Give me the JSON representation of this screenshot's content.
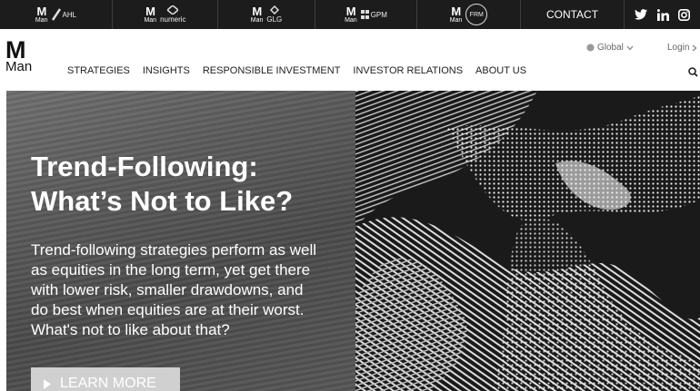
{
  "topbar": {
    "brands": [
      {
        "m": "M",
        "man": "Man",
        "sub": "AHL",
        "icon": "ahl-slash-icon"
      },
      {
        "m": "M",
        "man": "Man",
        "sub": "numeric",
        "icon": "numeric-diamond-icon"
      },
      {
        "m": "M",
        "man": "Man",
        "sub": "GLG",
        "icon": "glg-knot-icon"
      },
      {
        "m": "M",
        "man": "Man",
        "sub": "GPM",
        "icon": "gpm-grid-icon"
      },
      {
        "m": "M",
        "man": "Man",
        "sub": "FRM",
        "icon": "frm-circle-icon"
      }
    ],
    "contact": "CONTACT",
    "social": [
      "twitter-icon",
      "linkedin-icon",
      "instagram-icon"
    ]
  },
  "header": {
    "logo": {
      "big": "M",
      "small": "Man"
    },
    "nav": [
      "STRATEGIES",
      "INSIGHTS",
      "RESPONSIBLE INVESTMENT",
      "INVESTOR RELATIONS",
      "ABOUT US"
    ],
    "global": "Global",
    "login": "Login"
  },
  "hero": {
    "headline_line1": "Trend-Following:",
    "headline_line2": "What’s Not to Like?",
    "description_lines": [
      "Trend-following strategies perform as well",
      "as equities in the long term, yet get there",
      "with lower risk, smaller drawdowns, and",
      "do best when equities are at their worst.",
      "What's not to like about that?"
    ],
    "cta": "LEARN MORE"
  }
}
